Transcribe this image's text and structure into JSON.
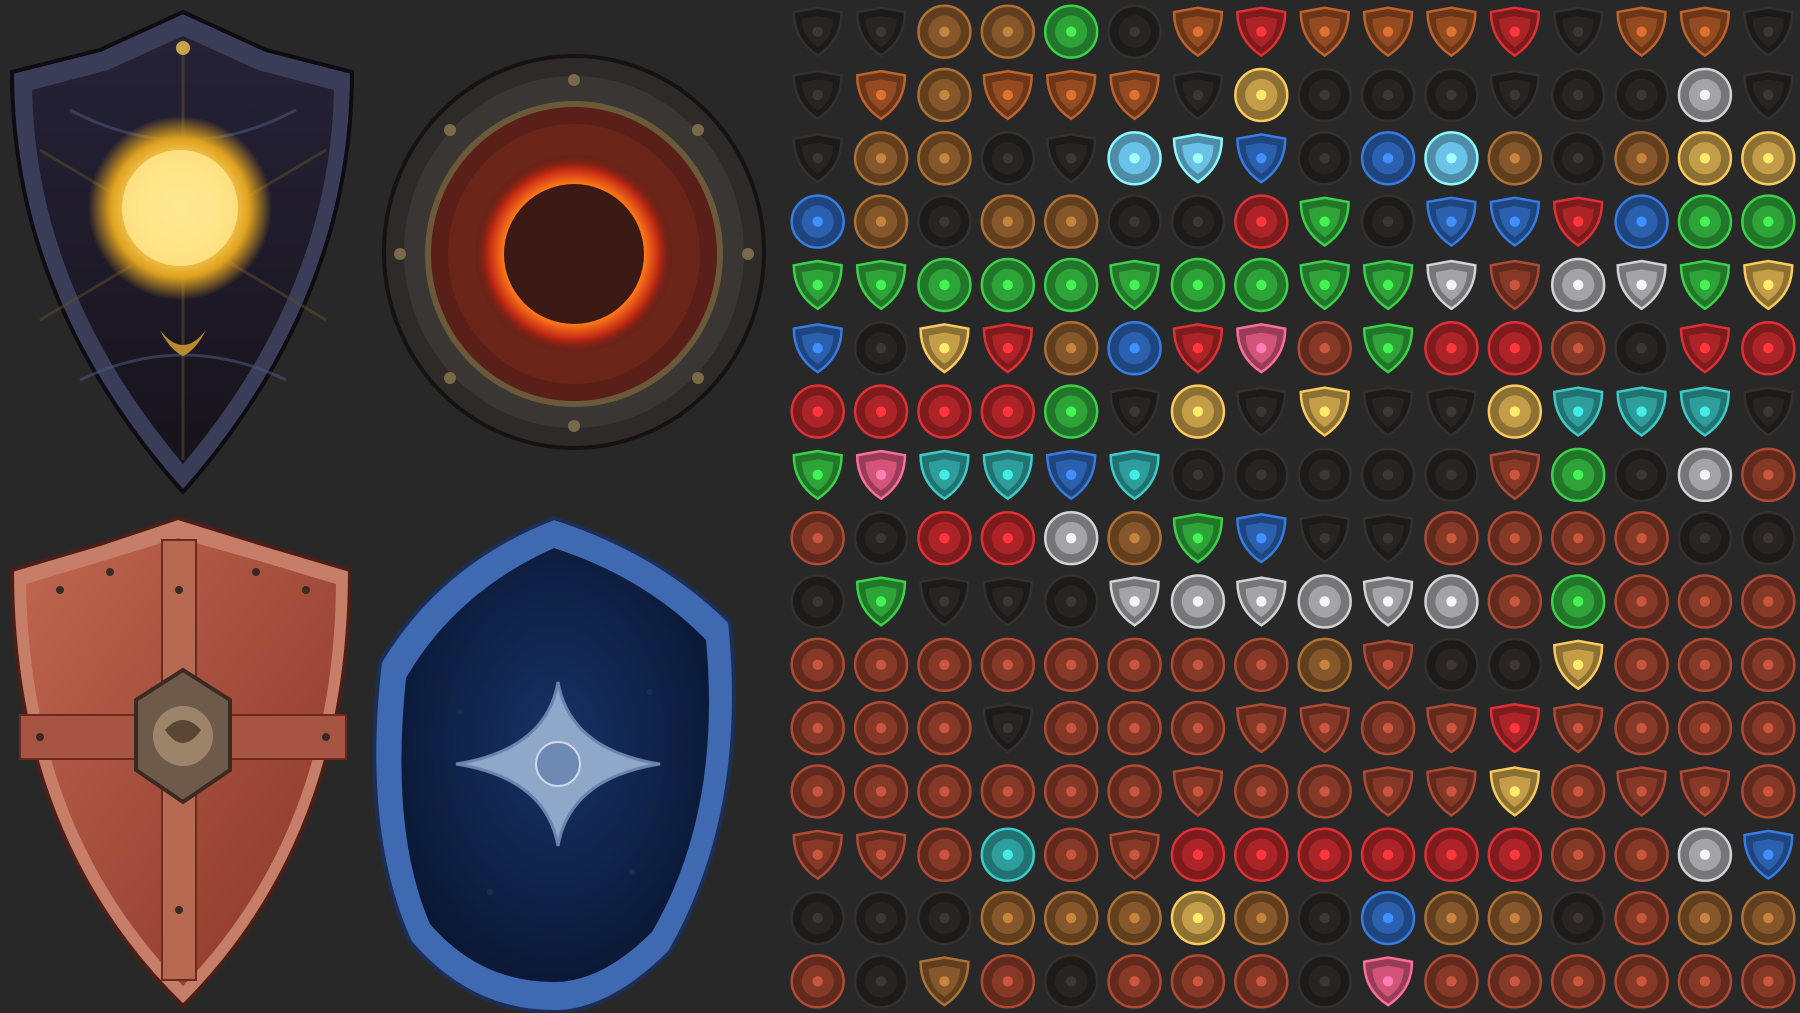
{
  "palette": {
    "background": "#282828",
    "gold": "#c9a24a",
    "bronze": "#8a5a2b",
    "wood": "#9a4e22",
    "red": "#b3262a",
    "green": "#2fa83a",
    "blue": "#2c63b5",
    "ice": "#6fc8f0",
    "silver": "#a8a8ad",
    "dark": "#2a2624",
    "copper": "#8c3b2a",
    "pink": "#d9577c",
    "teal": "#2fa3a0",
    "ember": "#ff7a18"
  },
  "hero_shields": [
    {
      "name": "golden-orb-kite-shield",
      "shape": "kite",
      "body": "#1e1a22",
      "rim": "#3a3d58",
      "emblem": "orb",
      "emblem_color": "#ffe27a"
    },
    {
      "name": "solar-eclipse-round-shield",
      "shape": "round",
      "body": "#2d2a29",
      "rim": "#3d3836",
      "emblem": "eclipse",
      "emblem_color": "#ff7a18"
    },
    {
      "name": "leather-cross-heater-shield",
      "shape": "heater",
      "body": "#a9483a",
      "rim": "#c67e68",
      "emblem": "cross",
      "emblem_color": "#b98b6b"
    },
    {
      "name": "blue-star-oval-shield",
      "shape": "oval",
      "body": "#0d1f44",
      "rim": "#3f69b1",
      "emblem": "star",
      "emblem_color": "#8fa7c8"
    }
  ],
  "icon_grid": {
    "rows": 16,
    "cols": 16,
    "items": [
      "dark-kite",
      "dark-kite",
      "bronze-round",
      "bronze-round",
      "green-round",
      "dark-round",
      "wood-kite",
      "red-kite",
      "wood-kite",
      "wood-kite",
      "wood-kite",
      "red-kite",
      "dark-kite",
      "wood-kite",
      "wood-kite",
      "dark-kite",
      "dark-kite",
      "wood-kite",
      "bronze-round",
      "wood-kite",
      "wood-kite",
      "wood-kite",
      "dark-kite",
      "gold-round",
      "dark-round",
      "dark-round",
      "dark-round",
      "dark-kite",
      "dark-round",
      "dark-round",
      "silver-round",
      "dark-kite",
      "dark-kite",
      "bronze-round",
      "bronze-round",
      "dark-round",
      "dark-kite",
      "ice-round",
      "ice-kite",
      "blue-kite",
      "dark-round",
      "blue-round",
      "ice-round",
      "bronze-round",
      "dark-round",
      "bronze-round",
      "gold-round",
      "gold-round",
      "blue-round",
      "bronze-round",
      "dark-round",
      "bronze-round",
      "bronze-round",
      "dark-round",
      "dark-round",
      "red-round",
      "green-kite",
      "dark-round",
      "blue-kite",
      "blue-kite",
      "red-kite",
      "blue-round",
      "green-round",
      "green-round",
      "green-kite",
      "green-kite",
      "green-round",
      "green-round",
      "green-round",
      "green-kite",
      "green-round",
      "green-round",
      "green-kite",
      "green-kite",
      "silver-kite",
      "copper-kite",
      "silver-round",
      "silver-kite",
      "green-kite",
      "gold-kite",
      "blue-kite",
      "dark-round",
      "gold-kite",
      "red-kite",
      "bronze-round",
      "blue-round",
      "red-kite",
      "pink-kite",
      "copper-round",
      "green-kite",
      "red-round",
      "red-round",
      "copper-round",
      "dark-round",
      "red-kite",
      "red-round",
      "red-round",
      "red-round",
      "red-round",
      "red-round",
      "green-round",
      "dark-kite",
      "gold-round",
      "dark-kite",
      "gold-kite",
      "dark-kite",
      "dark-kite",
      "gold-round",
      "teal-kite",
      "teal-kite",
      "teal-kite",
      "dark-kite",
      "green-kite",
      "pink-kite",
      "teal-kite",
      "teal-kite",
      "blue-kite",
      "teal-kite",
      "dark-round",
      "dark-round",
      "dark-round",
      "dark-round",
      "dark-round",
      "copper-kite",
      "green-round",
      "dark-round",
      "silver-round",
      "copper-round",
      "copper-round",
      "dark-round",
      "red-round",
      "red-round",
      "silver-round",
      "bronze-round",
      "green-kite",
      "blue-kite",
      "dark-kite",
      "dark-kite",
      "copper-round",
      "copper-round",
      "copper-round",
      "copper-round",
      "dark-round",
      "dark-round",
      "dark-round",
      "green-kite",
      "dark-kite",
      "dark-kite",
      "dark-round",
      "silver-kite",
      "silver-round",
      "silver-kite",
      "silver-round",
      "silver-kite",
      "silver-round",
      "copper-round",
      "green-round",
      "copper-round",
      "copper-round",
      "copper-round",
      "copper-round",
      "copper-round",
      "copper-round",
      "copper-round",
      "copper-round",
      "copper-round",
      "copper-round",
      "copper-round",
      "bronze-round",
      "copper-kite",
      "dark-round",
      "dark-round",
      "gold-kite",
      "copper-round",
      "copper-round",
      "copper-round",
      "copper-round",
      "copper-round",
      "copper-round",
      "dark-kite",
      "copper-round",
      "copper-round",
      "copper-round",
      "copper-kite",
      "copper-kite",
      "copper-round",
      "copper-kite",
      "red-kite",
      "copper-kite",
      "copper-round",
      "copper-round",
      "copper-round",
      "copper-round",
      "copper-round",
      "copper-round",
      "copper-round",
      "copper-round",
      "copper-round",
      "copper-kite",
      "copper-round",
      "copper-round",
      "copper-kite",
      "copper-kite",
      "gold-kite",
      "copper-round",
      "copper-kite",
      "copper-kite",
      "copper-round",
      "copper-kite",
      "copper-kite",
      "copper-round",
      "teal-round",
      "copper-round",
      "copper-kite",
      "red-round",
      "red-round",
      "red-round",
      "red-round",
      "red-round",
      "red-round",
      "copper-round",
      "copper-round",
      "silver-round",
      "blue-kite",
      "dark-round",
      "dark-round",
      "dark-round",
      "bronze-round",
      "bronze-round",
      "bronze-round",
      "gold-round",
      "bronze-round",
      "dark-round",
      "blue-round",
      "bronze-round",
      "bronze-round",
      "dark-round",
      "copper-round",
      "bronze-round",
      "bronze-round",
      "copper-round",
      "dark-round",
      "bronze-kite",
      "copper-round",
      "dark-round",
      "copper-round",
      "copper-round",
      "copper-round",
      "dark-round",
      "pink-kite",
      "copper-round",
      "copper-round",
      "copper-round",
      "copper-round",
      "copper-round",
      "copper-round"
    ]
  }
}
